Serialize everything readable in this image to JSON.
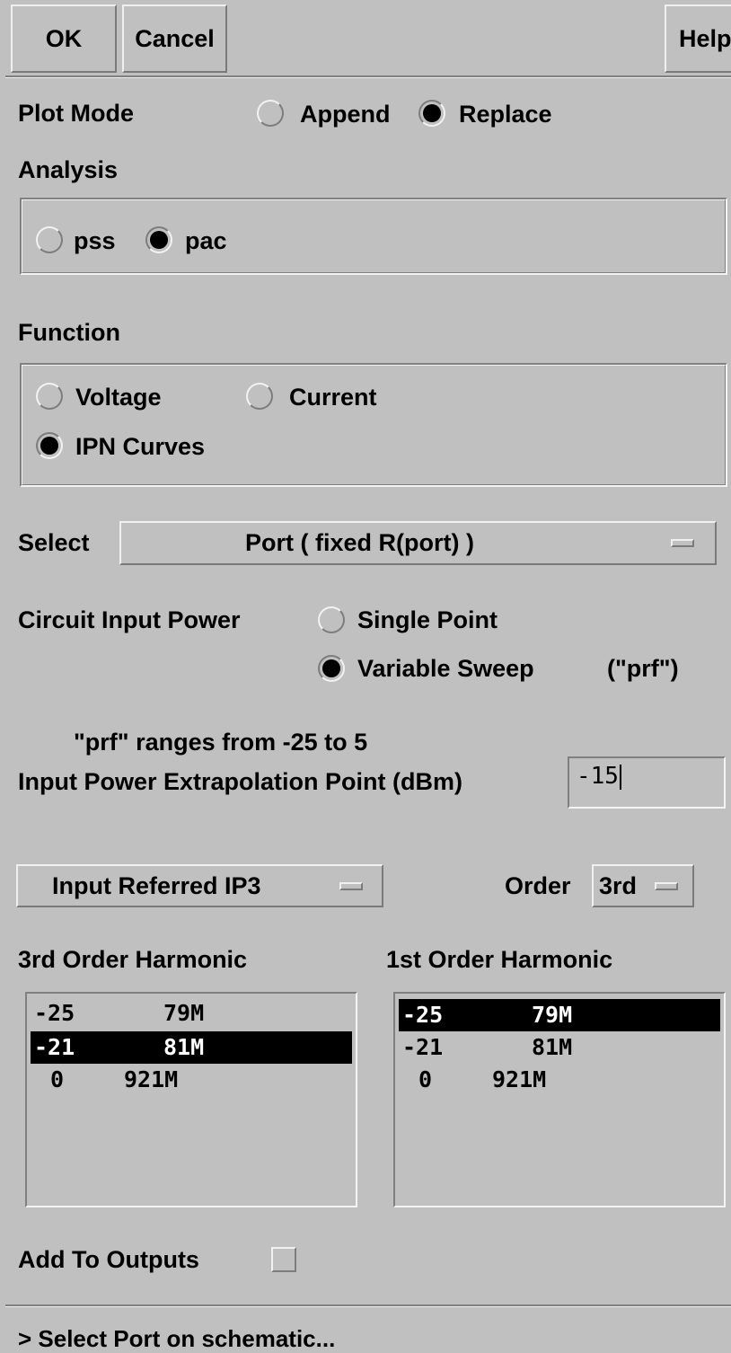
{
  "buttons": {
    "ok": "OK",
    "cancel": "Cancel",
    "help": "Help"
  },
  "plot_mode": {
    "label": "Plot Mode",
    "append": "Append",
    "replace": "Replace",
    "selected": "Replace"
  },
  "analysis": {
    "label": "Analysis",
    "pss": "pss",
    "pac": "pac",
    "selected": "pac"
  },
  "function": {
    "label": "Function",
    "voltage": "Voltage",
    "current": "Current",
    "ipn": "IPN Curves",
    "selected": "IPN Curves"
  },
  "select": {
    "label": "Select",
    "value": "Port ( fixed R(port) )"
  },
  "circuit_input_power": {
    "label": "Circuit Input Power",
    "single_point": "Single Point",
    "variable_sweep": "Variable Sweep",
    "sweep_var": "(\"prf\")",
    "selected": "Variable Sweep"
  },
  "range_note": "\"prf\" ranges from -25 to 5",
  "extrapolation": {
    "label": "Input Power Extrapolation Point (dBm)",
    "value": "-15"
  },
  "measurement": {
    "value": "Input Referred IP3"
  },
  "order": {
    "label": "Order",
    "value": "3rd"
  },
  "harmonic_3rd": {
    "label": "3rd Order Harmonic",
    "rows": [
      {
        "a": "-25",
        "b": "79M",
        "selected": false
      },
      {
        "a": "-21",
        "b": "81M",
        "selected": true
      },
      {
        "a": "0",
        "b": "921M",
        "selected": false
      }
    ]
  },
  "harmonic_1st": {
    "label": "1st Order Harmonic",
    "rows": [
      {
        "a": "-25",
        "b": "79M",
        "selected": true
      },
      {
        "a": "-21",
        "b": "81M",
        "selected": false
      },
      {
        "a": "0",
        "b": "921M",
        "selected": false
      }
    ]
  },
  "add_to_outputs": {
    "label": "Add To Outputs",
    "checked": false
  },
  "status": "> Select Port on schematic..."
}
